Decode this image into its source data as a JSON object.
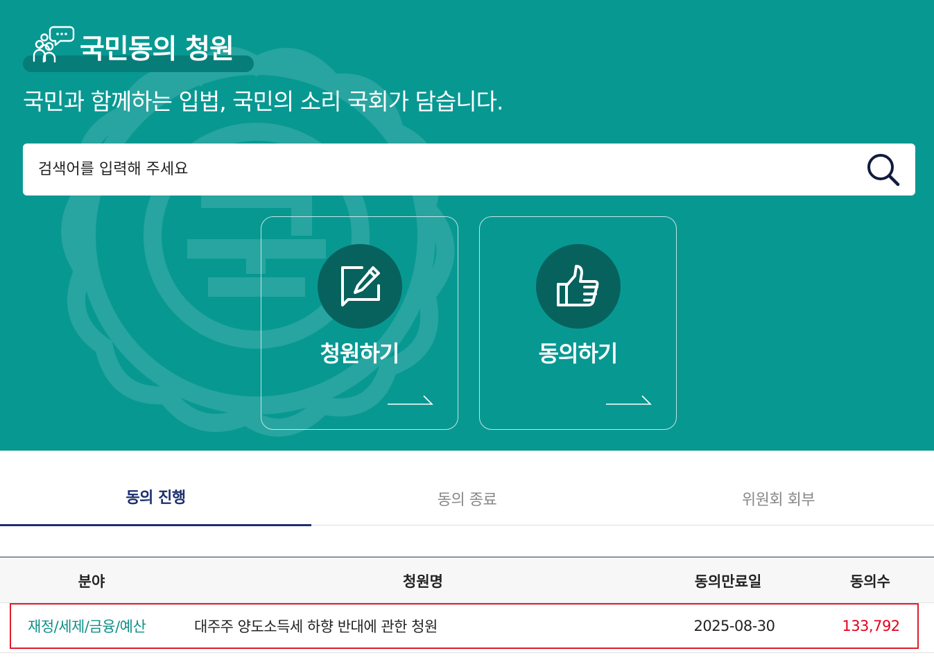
{
  "header": {
    "title": "국민동의 청원",
    "tagline": "국민과 함께하는 입법, 국민의 소리 국회가 담습니다."
  },
  "search": {
    "placeholder": "검색어를 입력해 주세요",
    "icon": "search-icon"
  },
  "actions": [
    {
      "label": "청원하기",
      "icon": "edit-icon"
    },
    {
      "label": "동의하기",
      "icon": "thumbs-up-icon"
    }
  ],
  "tabs": [
    {
      "label": "동의 진행",
      "active": true
    },
    {
      "label": "동의 종료",
      "active": false
    },
    {
      "label": "위원회 회부",
      "active": false
    }
  ],
  "table": {
    "columns": [
      "분야",
      "청원명",
      "동의만료일",
      "동의수"
    ],
    "rows": [
      {
        "category": "재정/세제/금융/예산",
        "title": "대주주 양도소득세 하향 반대에 관한 청원",
        "deadline": "2025-08-30",
        "count": "133,792"
      }
    ]
  },
  "colors": {
    "hero_bg": "#089892",
    "circle_bg": "#07625e",
    "active_tab": "#1a2f6e",
    "category_text": "#0f8f87",
    "count_text": "#e3001b",
    "highlight_border": "#dd1c2a"
  }
}
